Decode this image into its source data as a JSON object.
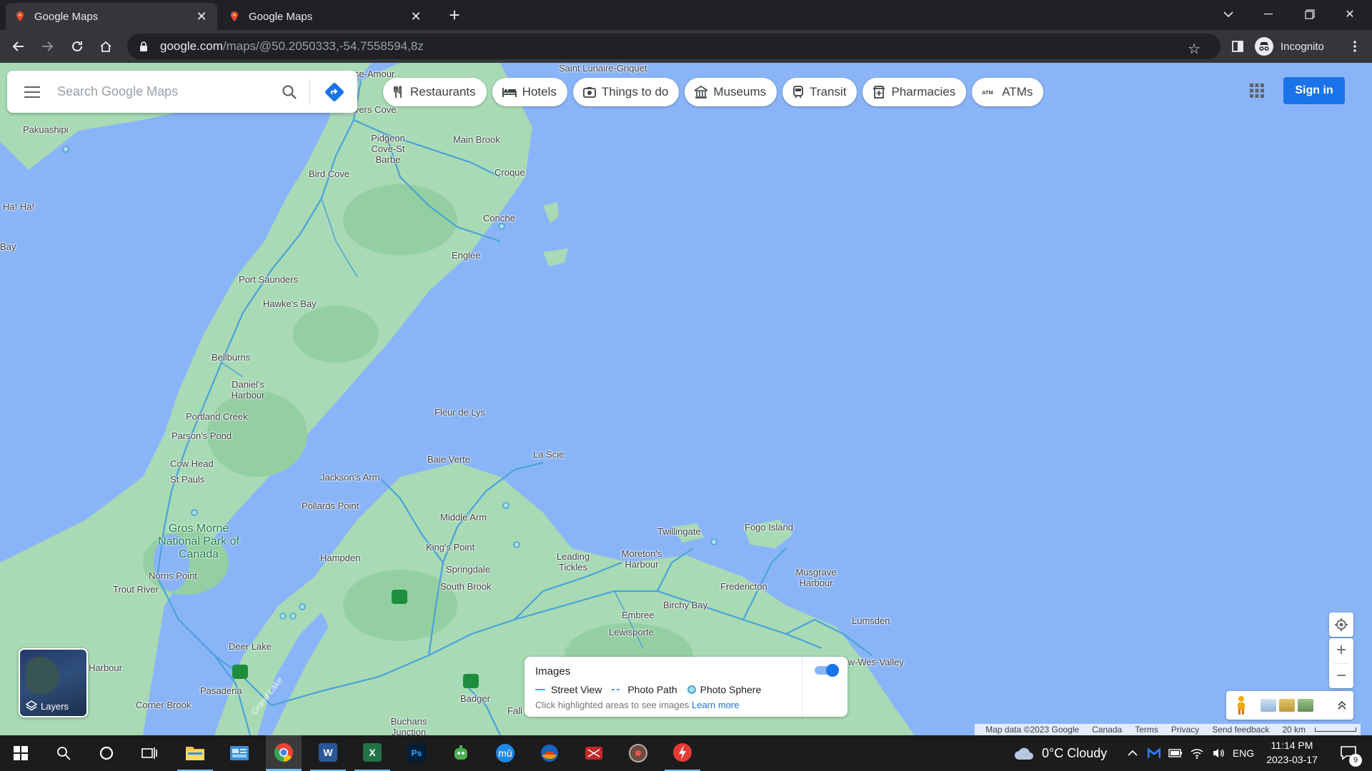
{
  "browser": {
    "tabs": [
      {
        "title": "Google Maps",
        "active": true
      },
      {
        "title": "Google Maps",
        "active": false
      }
    ],
    "url_host": "google.com",
    "url_path": "/maps/@50.2050333,-54.7558594,8z",
    "profile_label": "Incognito"
  },
  "maps": {
    "search_placeholder": "Search Google Maps",
    "chips": [
      {
        "label": "Restaurants",
        "icon": "fork-knife-icon"
      },
      {
        "label": "Hotels",
        "icon": "bed-icon"
      },
      {
        "label": "Things to do",
        "icon": "camera-icon"
      },
      {
        "label": "Museums",
        "icon": "museum-icon"
      },
      {
        "label": "Transit",
        "icon": "train-icon"
      },
      {
        "label": "Pharmacies",
        "icon": "pharmacy-icon"
      },
      {
        "label": "ATMs",
        "icon": "atm-icon"
      }
    ],
    "sign_in": "Sign in",
    "layers_label": "Layers",
    "images_panel": {
      "title": "Images",
      "legend": [
        "Street View",
        "Photo Path",
        "Photo Sphere"
      ],
      "hint": "Click highlighted areas to see images",
      "learn_more": "Learn more",
      "toggle_on": true
    },
    "attribution": {
      "map_data": "Map data ©2023 Google",
      "links": [
        "Canada",
        "Terms",
        "Privacy",
        "Send feedback"
      ],
      "scale": "20 km"
    },
    "places": [
      "Saint Lunaire-Griquet",
      "Anse-Amour",
      "Pakuashipi",
      "Ha! Ha!",
      "Bay",
      "Savers Cove",
      "Pidgeon Cove-St Barbe",
      "Main Brook",
      "Bird Cove",
      "Croque",
      "Conche",
      "Englee",
      "Port Saunders",
      "Hawke's Bay",
      "Bellburns",
      "Daniel's Harbour",
      "Portland Creek",
      "Parson's Pond",
      "Cow Head",
      "St Pauls",
      "Fleur de Lys",
      "Baie Verte",
      "La Scie",
      "Jackson's Arm",
      "Pollards Point",
      "Middle Arm",
      "Twillingate",
      "Fogo Island",
      "King's Point",
      "Leading Tickles",
      "Moreton's Harbour",
      "Springdale",
      "South Brook",
      "Musgrave Harbour",
      "Hampden",
      "Norris Point",
      "Trout River",
      "Fredericton",
      "Birchy Bay",
      "Embree",
      "Lewisporte",
      "Lumsden",
      "New-Wes-Valley",
      "Deer Lake",
      "Harbour",
      "Pasadena",
      "Corner Brook",
      "Badger",
      "Buchans Junction",
      "Fall"
    ],
    "park_label": "Gros Morne National Park of Canada",
    "water_label": "Grand Lake"
  },
  "taskbar": {
    "weather": "0°C  Cloudy",
    "language": "ENG",
    "time": "11:14 PM",
    "date": "2023-03-17",
    "notifications": "9",
    "apps": [
      {
        "name": "file-explorer",
        "color": "#f6c343"
      },
      {
        "name": "control-panel",
        "color": "#3a8fd9"
      },
      {
        "name": "chrome",
        "color": "#ea4335"
      },
      {
        "name": "word",
        "letter": "W",
        "color": "#2b579a"
      },
      {
        "name": "excel",
        "letter": "X",
        "color": "#217346"
      },
      {
        "name": "photoshop",
        "letter": "Ps",
        "color": "#001e36"
      },
      {
        "name": "app-green",
        "color": "#4caf50"
      },
      {
        "name": "app-m",
        "letter": "m",
        "color": "#1e88e5"
      },
      {
        "name": "app-sphere",
        "color": "#1565c0"
      },
      {
        "name": "app-red",
        "color": "#c62828"
      },
      {
        "name": "app-disc",
        "color": "#6d4c41"
      },
      {
        "name": "app-flash",
        "color": "#e53935"
      }
    ]
  },
  "colors": {
    "water": "#8ab4f8",
    "land": "#a8dab5",
    "road": "#4aa3d8",
    "accent": "#1a73e8"
  }
}
